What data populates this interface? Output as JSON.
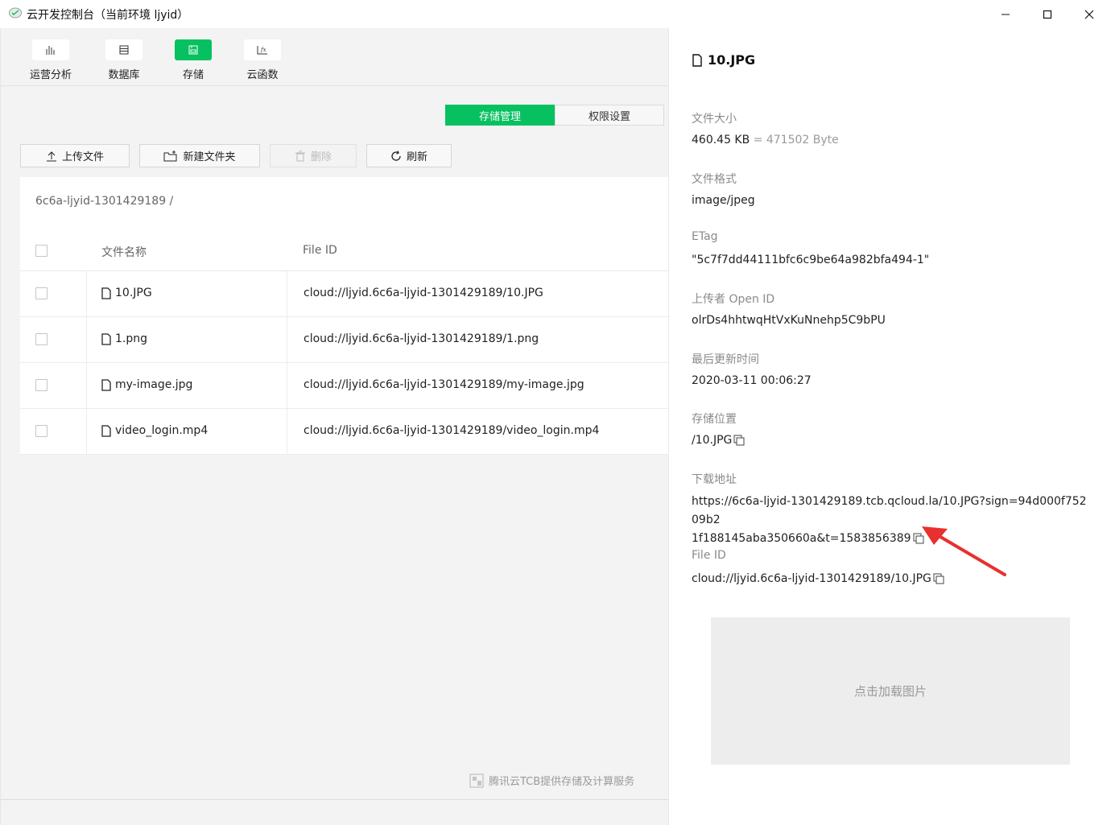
{
  "window": {
    "title": "云开发控制台（当前环境 ljyid）"
  },
  "nav": [
    {
      "label": "运营分析",
      "icon": "bar-chart-icon"
    },
    {
      "label": "数据库",
      "icon": "database-icon"
    },
    {
      "label": "存储",
      "icon": "storage-icon",
      "active": true
    },
    {
      "label": "云函数",
      "icon": "function-icon"
    }
  ],
  "tabs": {
    "manage": "存储管理",
    "permission": "权限设置"
  },
  "toolbar": {
    "upload": "上传文件",
    "new_folder": "新建文件夹",
    "delete": "删除",
    "refresh": "刷新"
  },
  "table": {
    "path": "6c6a-ljyid-1301429189 /",
    "col_name": "文件名称",
    "col_id": "File ID",
    "rows": [
      {
        "name": "10.JPG",
        "file_id": "cloud://ljyid.6c6a-ljyid-1301429189/10.JPG"
      },
      {
        "name": "1.png",
        "file_id": "cloud://ljyid.6c6a-ljyid-1301429189/1.png"
      },
      {
        "name": "my-image.jpg",
        "file_id": "cloud://ljyid.6c6a-ljyid-1301429189/my-image.jpg"
      },
      {
        "name": "video_login.mp4",
        "file_id": "cloud://ljyid.6c6a-ljyid-1301429189/video_login.mp4"
      }
    ]
  },
  "footer": {
    "text": "腾讯云TCB提供存储及计算服务"
  },
  "detail": {
    "file_name": "10.JPG",
    "size_label": "文件大小",
    "size_value": "460.45 KB",
    "size_bytes": "= 471502 Byte",
    "format_label": "文件格式",
    "format_value": "image/jpeg",
    "etag_label": "ETag",
    "etag_value": "\"5c7f7dd44111bfc6c9be64a982bfa494-1\"",
    "uploader_label": "上传者 Open ID",
    "uploader_value": "olrDs4hhtwqHtVxKuNnehp5C9bPU",
    "updated_label": "最后更新时间",
    "updated_value": "2020-03-11 00:06:27",
    "location_label": "存储位置",
    "location_value": "/10.JPG",
    "download_label": "下载地址",
    "download_line1": "https://6c6a-ljyid-1301429189.tcb.qcloud.la/10.JPG?sign=94d000f75209b2",
    "download_line2": "1f188145aba350660a&t=1583856389",
    "fileid_label": "File ID",
    "fileid_value": "cloud://ljyid.6c6a-ljyid-1301429189/10.JPG",
    "preview_text": "点击加载图片"
  },
  "colors": {
    "accent": "#07c160",
    "annotation_arrow": "#e8302f"
  }
}
